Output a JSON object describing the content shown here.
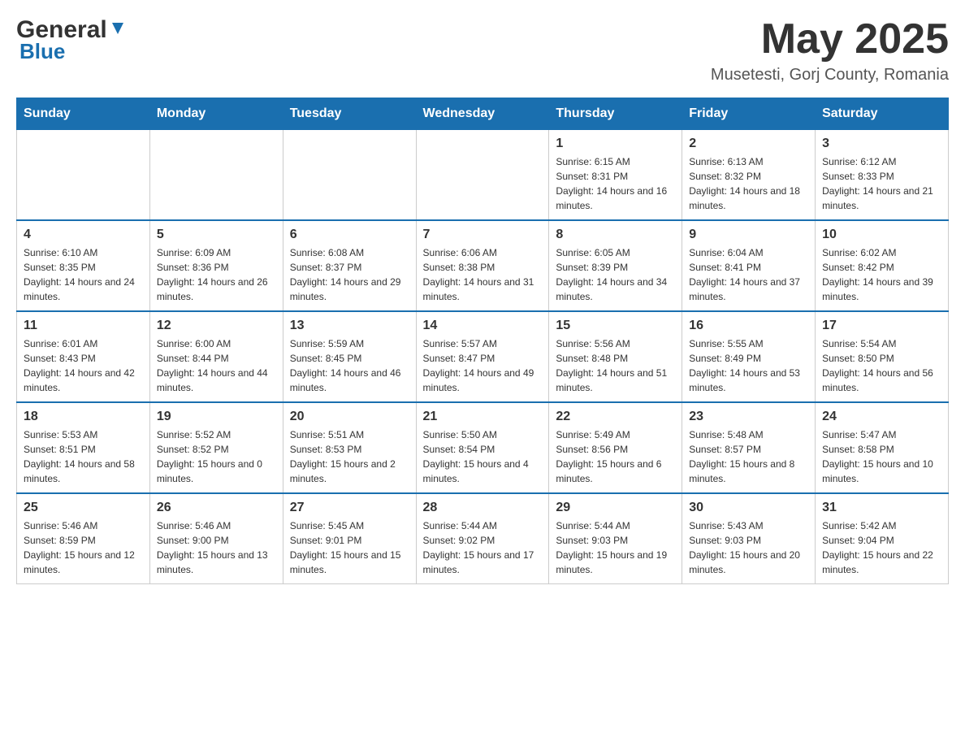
{
  "header": {
    "logo_general": "General",
    "logo_blue": "Blue",
    "month_title": "May 2025",
    "location": "Musetesti, Gorj County, Romania"
  },
  "weekdays": [
    "Sunday",
    "Monday",
    "Tuesday",
    "Wednesday",
    "Thursday",
    "Friday",
    "Saturday"
  ],
  "weeks": [
    [
      {
        "day": "",
        "info": ""
      },
      {
        "day": "",
        "info": ""
      },
      {
        "day": "",
        "info": ""
      },
      {
        "day": "",
        "info": ""
      },
      {
        "day": "1",
        "info": "Sunrise: 6:15 AM\nSunset: 8:31 PM\nDaylight: 14 hours and 16 minutes."
      },
      {
        "day": "2",
        "info": "Sunrise: 6:13 AM\nSunset: 8:32 PM\nDaylight: 14 hours and 18 minutes."
      },
      {
        "day": "3",
        "info": "Sunrise: 6:12 AM\nSunset: 8:33 PM\nDaylight: 14 hours and 21 minutes."
      }
    ],
    [
      {
        "day": "4",
        "info": "Sunrise: 6:10 AM\nSunset: 8:35 PM\nDaylight: 14 hours and 24 minutes."
      },
      {
        "day": "5",
        "info": "Sunrise: 6:09 AM\nSunset: 8:36 PM\nDaylight: 14 hours and 26 minutes."
      },
      {
        "day": "6",
        "info": "Sunrise: 6:08 AM\nSunset: 8:37 PM\nDaylight: 14 hours and 29 minutes."
      },
      {
        "day": "7",
        "info": "Sunrise: 6:06 AM\nSunset: 8:38 PM\nDaylight: 14 hours and 31 minutes."
      },
      {
        "day": "8",
        "info": "Sunrise: 6:05 AM\nSunset: 8:39 PM\nDaylight: 14 hours and 34 minutes."
      },
      {
        "day": "9",
        "info": "Sunrise: 6:04 AM\nSunset: 8:41 PM\nDaylight: 14 hours and 37 minutes."
      },
      {
        "day": "10",
        "info": "Sunrise: 6:02 AM\nSunset: 8:42 PM\nDaylight: 14 hours and 39 minutes."
      }
    ],
    [
      {
        "day": "11",
        "info": "Sunrise: 6:01 AM\nSunset: 8:43 PM\nDaylight: 14 hours and 42 minutes."
      },
      {
        "day": "12",
        "info": "Sunrise: 6:00 AM\nSunset: 8:44 PM\nDaylight: 14 hours and 44 minutes."
      },
      {
        "day": "13",
        "info": "Sunrise: 5:59 AM\nSunset: 8:45 PM\nDaylight: 14 hours and 46 minutes."
      },
      {
        "day": "14",
        "info": "Sunrise: 5:57 AM\nSunset: 8:47 PM\nDaylight: 14 hours and 49 minutes."
      },
      {
        "day": "15",
        "info": "Sunrise: 5:56 AM\nSunset: 8:48 PM\nDaylight: 14 hours and 51 minutes."
      },
      {
        "day": "16",
        "info": "Sunrise: 5:55 AM\nSunset: 8:49 PM\nDaylight: 14 hours and 53 minutes."
      },
      {
        "day": "17",
        "info": "Sunrise: 5:54 AM\nSunset: 8:50 PM\nDaylight: 14 hours and 56 minutes."
      }
    ],
    [
      {
        "day": "18",
        "info": "Sunrise: 5:53 AM\nSunset: 8:51 PM\nDaylight: 14 hours and 58 minutes."
      },
      {
        "day": "19",
        "info": "Sunrise: 5:52 AM\nSunset: 8:52 PM\nDaylight: 15 hours and 0 minutes."
      },
      {
        "day": "20",
        "info": "Sunrise: 5:51 AM\nSunset: 8:53 PM\nDaylight: 15 hours and 2 minutes."
      },
      {
        "day": "21",
        "info": "Sunrise: 5:50 AM\nSunset: 8:54 PM\nDaylight: 15 hours and 4 minutes."
      },
      {
        "day": "22",
        "info": "Sunrise: 5:49 AM\nSunset: 8:56 PM\nDaylight: 15 hours and 6 minutes."
      },
      {
        "day": "23",
        "info": "Sunrise: 5:48 AM\nSunset: 8:57 PM\nDaylight: 15 hours and 8 minutes."
      },
      {
        "day": "24",
        "info": "Sunrise: 5:47 AM\nSunset: 8:58 PM\nDaylight: 15 hours and 10 minutes."
      }
    ],
    [
      {
        "day": "25",
        "info": "Sunrise: 5:46 AM\nSunset: 8:59 PM\nDaylight: 15 hours and 12 minutes."
      },
      {
        "day": "26",
        "info": "Sunrise: 5:46 AM\nSunset: 9:00 PM\nDaylight: 15 hours and 13 minutes."
      },
      {
        "day": "27",
        "info": "Sunrise: 5:45 AM\nSunset: 9:01 PM\nDaylight: 15 hours and 15 minutes."
      },
      {
        "day": "28",
        "info": "Sunrise: 5:44 AM\nSunset: 9:02 PM\nDaylight: 15 hours and 17 minutes."
      },
      {
        "day": "29",
        "info": "Sunrise: 5:44 AM\nSunset: 9:03 PM\nDaylight: 15 hours and 19 minutes."
      },
      {
        "day": "30",
        "info": "Sunrise: 5:43 AM\nSunset: 9:03 PM\nDaylight: 15 hours and 20 minutes."
      },
      {
        "day": "31",
        "info": "Sunrise: 5:42 AM\nSunset: 9:04 PM\nDaylight: 15 hours and 22 minutes."
      }
    ]
  ]
}
